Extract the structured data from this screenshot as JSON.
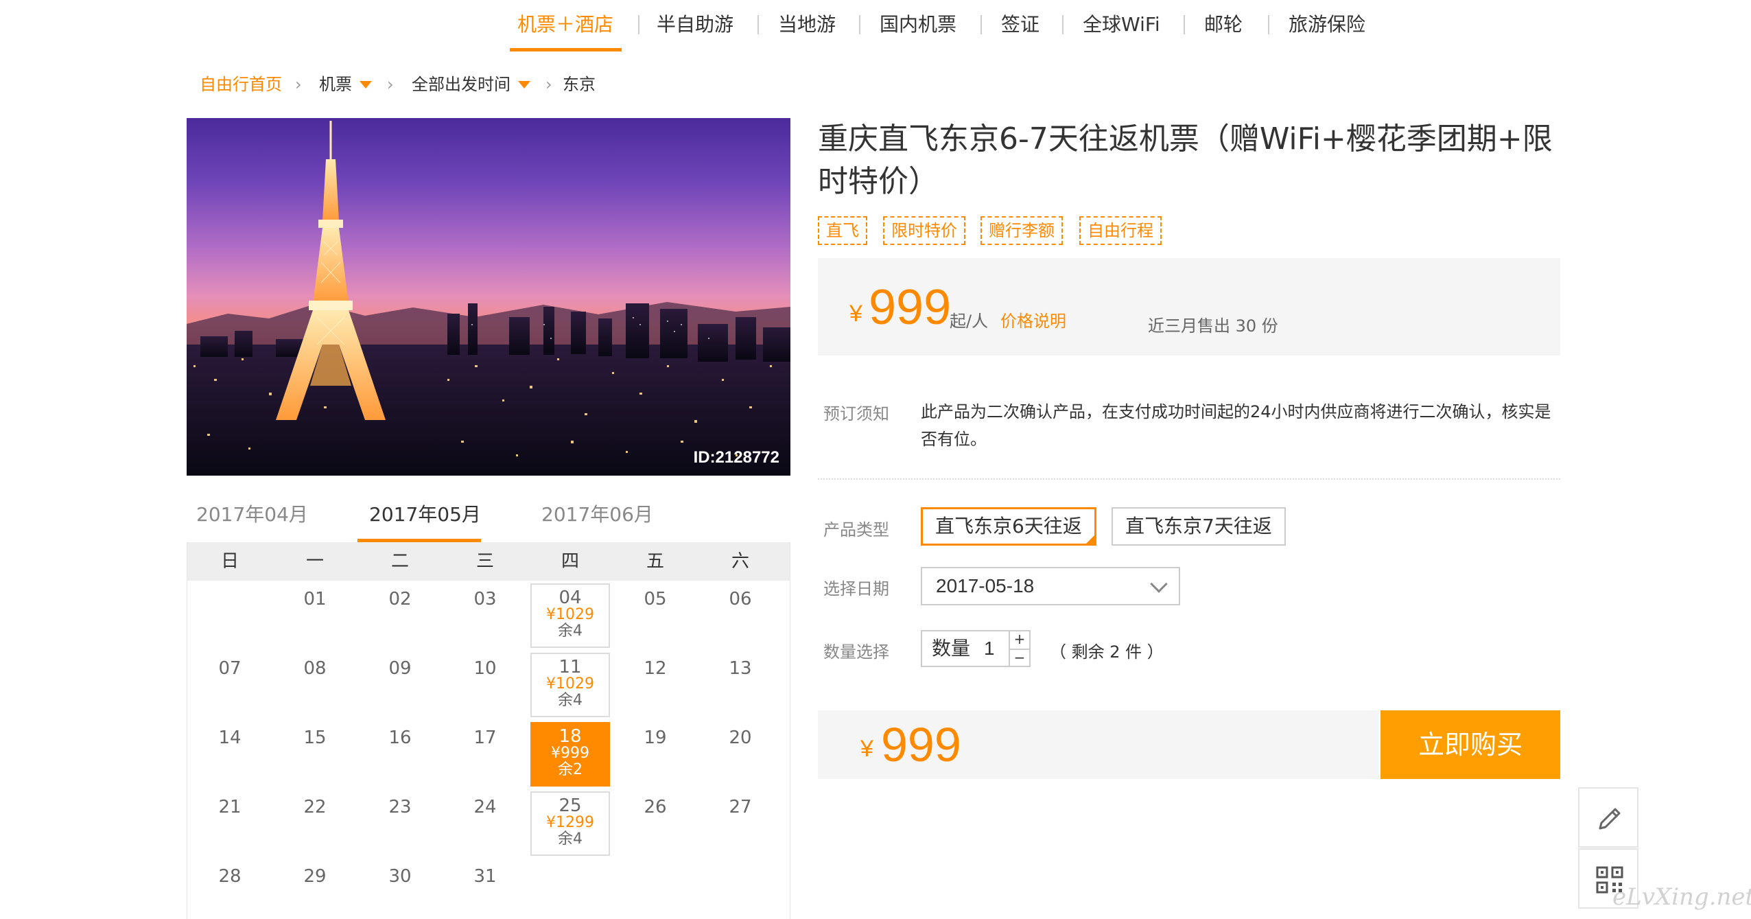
{
  "nav": {
    "items": [
      {
        "label": "机票＋酒店",
        "active": true
      },
      {
        "label": "半自助游"
      },
      {
        "label": "当地游"
      },
      {
        "label": "国内机票"
      },
      {
        "label": "签证"
      },
      {
        "label": "全球WiFi"
      },
      {
        "label": "邮轮"
      },
      {
        "label": "旅游保险"
      }
    ]
  },
  "breadcrumb": {
    "home": "自由行首页",
    "items": [
      "机票",
      "全部出发时间",
      "东京"
    ],
    "separator": "›"
  },
  "hero": {
    "id_label": "ID:2128772"
  },
  "calendar": {
    "months": [
      "2017年04月",
      "2017年05月",
      "2017年06月"
    ],
    "active_month": "2017年05月",
    "weekdays": [
      "日",
      "一",
      "二",
      "三",
      "四",
      "五",
      "六"
    ],
    "days": [
      {
        "d": "01"
      },
      {
        "d": "02"
      },
      {
        "d": "03"
      },
      {
        "d": "04",
        "price": "¥1029",
        "left": "余4"
      },
      {
        "d": "05"
      },
      {
        "d": "06"
      },
      {
        "d": "07"
      },
      {
        "d": "08"
      },
      {
        "d": "09"
      },
      {
        "d": "10"
      },
      {
        "d": "11",
        "price": "¥1029",
        "left": "余4"
      },
      {
        "d": "12"
      },
      {
        "d": "13"
      },
      {
        "d": "14"
      },
      {
        "d": "15"
      },
      {
        "d": "16"
      },
      {
        "d": "17"
      },
      {
        "d": "18",
        "price": "¥999",
        "left": "余2",
        "selected": true
      },
      {
        "d": "19"
      },
      {
        "d": "20"
      },
      {
        "d": "21"
      },
      {
        "d": "22"
      },
      {
        "d": "23"
      },
      {
        "d": "24"
      },
      {
        "d": "25",
        "price": "¥1299",
        "left": "余4"
      },
      {
        "d": "26"
      },
      {
        "d": "27"
      },
      {
        "d": "28"
      },
      {
        "d": "29"
      },
      {
        "d": "30"
      },
      {
        "d": "31"
      }
    ]
  },
  "product": {
    "title": "重庆直飞东京6-7天往返机票（赠WiFi+樱花季团期+限时特价）",
    "tags": [
      "直飞",
      "限时特价",
      "赠行李额",
      "自由行程"
    ],
    "currency": "¥",
    "price": "999",
    "price_unit": "起/人",
    "price_note_link": "价格说明",
    "sold_text": "近三月售出 30 份",
    "notice_label": "预订须知",
    "notice_text": "此产品为二次确认产品，在支付成功时间起的24小时内供应商将进行二次确认，核实是否有位。",
    "type_label": "产品类型",
    "types": [
      {
        "label": "直飞东京6天往返",
        "selected": true
      },
      {
        "label": "直飞东京7天往返"
      }
    ],
    "date_label": "选择日期",
    "date_value": "2017-05-18",
    "qty_label": "数量选择",
    "qty_inner_label": "数量",
    "qty_value": "1",
    "qty_plus": "+",
    "qty_minus": "−",
    "remain_text": "（ 剩余 2 件 ）",
    "total_price": "999",
    "buy_label": "立即购买"
  },
  "watermark": "eLvXing.net",
  "colors": {
    "accent": "#ff8a00",
    "buy_button": "#ff9e00",
    "panel_bg": "#f5f5f5"
  },
  "icons": [
    "pencil-icon",
    "qr-code-icon",
    "chevron-down-icon",
    "dropdown-caret-icon",
    "check-corner-icon"
  ]
}
